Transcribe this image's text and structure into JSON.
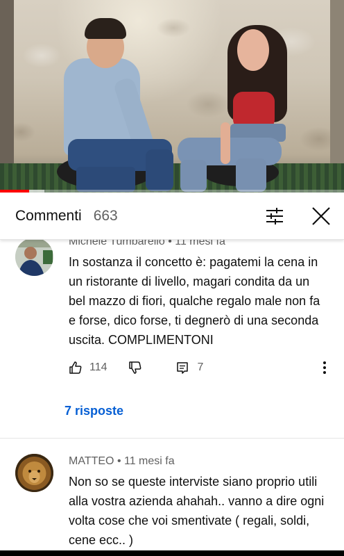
{
  "video": {
    "progress_fraction": 0.085,
    "buffer_fraction": 0.13
  },
  "panel": {
    "title": "Commenti",
    "count": "663",
    "sort_icon": "tune-icon",
    "close_icon": "close-icon"
  },
  "comments": [
    {
      "author": "Michele Tumbarello",
      "time": "11 mesi fa",
      "text": "In sostanza il concetto è: pagatemi la cena in un ristorante di livello, magari condita da un bel mazzo di fiori, qualche regalo male non fa e forse, dico forse, ti degnerò di una seconda uscita. COMPLIMENTONI",
      "likes": "114",
      "reply_count": "7",
      "replies_link": "7 risposte"
    },
    {
      "author": "MATTEO",
      "time": "11 mesi fa",
      "text": "Non so se queste interviste siano proprio utili alla vostra azienda ahahah.. vanno a dire ogni volta cose che voi smentivate ( regali, soldi, cene ecc.. )"
    }
  ],
  "colors": {
    "link": "#065fd4",
    "progress": "#ff0000",
    "secondary_text": "#606060"
  }
}
